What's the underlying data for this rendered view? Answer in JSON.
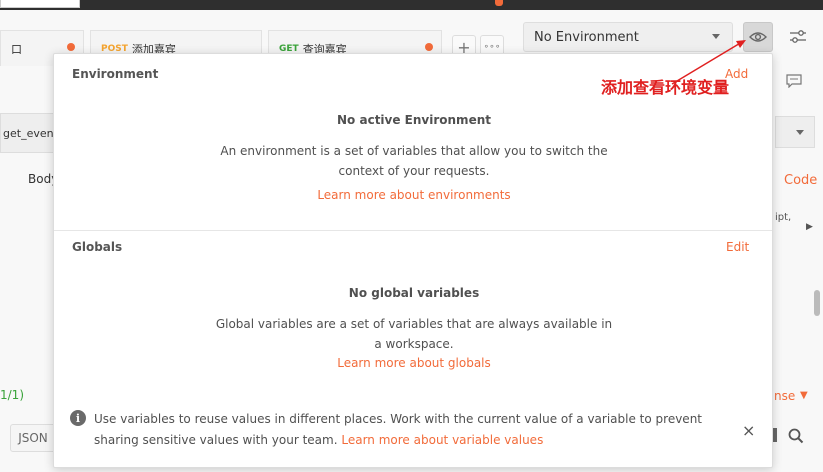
{
  "tabs": [
    {
      "method": "",
      "label": "口",
      "unsaved": true
    },
    {
      "method": "POST",
      "label": "添加嘉宾",
      "unsaved": false
    },
    {
      "method": "GET",
      "label": "查询嘉宾",
      "unsaved": true
    }
  ],
  "tab_buttons": {
    "add": "+",
    "more": "∘∘∘"
  },
  "background": {
    "url_fragment": "get_event",
    "body_label": "Body",
    "left_fragment": "1/1)",
    "json_label": "JSON",
    "code_fragment": "Code",
    "ript_fragment": "ipt,",
    "nse_fragment": "nse"
  },
  "environment": {
    "selected": "No Environment"
  },
  "annotation": {
    "text": "添加查看环境变量"
  },
  "popover": {
    "environment": {
      "title": "Environment",
      "action": "Add",
      "empty_title": "No active Environment",
      "empty_desc": "An environment is a set of variables that allow you to switch the context of your requests.",
      "link": "Learn more about environments"
    },
    "globals": {
      "title": "Globals",
      "action": "Edit",
      "empty_title": "No global variables",
      "empty_desc": "Global variables are a set of variables that are always available in a workspace.",
      "link": "Learn more about globals"
    },
    "footnote": {
      "text": "Use variables to reuse values in different places. Work with the current value of a variable to prevent sharing sensitive values with your team.",
      "link": "Learn more about variable values"
    },
    "close": "×"
  },
  "colors": {
    "accent": "#f26b3a",
    "annotation": "#e02020",
    "post": "#f4a430",
    "get": "#3aa33a"
  }
}
